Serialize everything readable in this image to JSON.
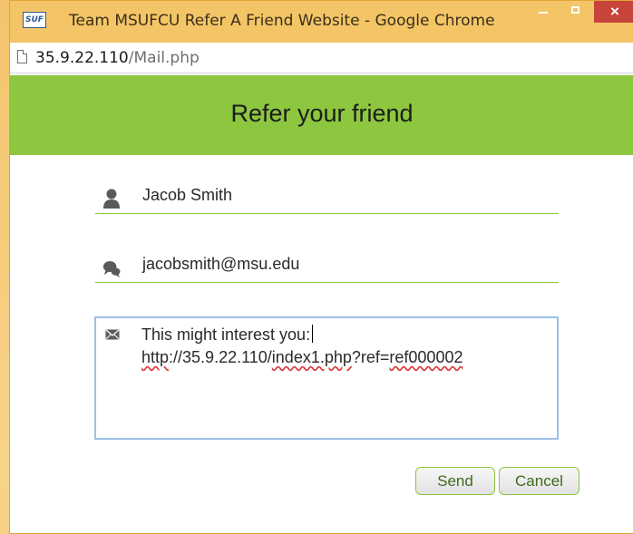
{
  "window": {
    "title": "Team MSUFCU Refer A Friend Website - Google Chrome",
    "logo_text": "SUF",
    "controls": {
      "close_label": "×"
    }
  },
  "urlbar": {
    "host": "35.9.22.110",
    "path": "/Mail.php"
  },
  "page": {
    "header_title": "Refer your friend",
    "name_value": "Jacob Smith",
    "email_value": "jacobsmith@msu.edu",
    "message": {
      "line1": "This might interest you:",
      "line2_prefix": "http",
      "line2_middle": "://35.9.22.110/",
      "line2_file": "index1.php",
      "line2_query": "?ref=",
      "line2_ref": "ref000002"
    },
    "send_label": "Send",
    "cancel_label": "Cancel"
  },
  "colors": {
    "accent_green": "#8dc63f",
    "titlebar": "#f4c567",
    "close_red": "#c7443a",
    "textarea_focus": "#9bc1e8"
  },
  "icons": [
    "app-logo",
    "page-icon",
    "user-icon",
    "chat-bubbles-icon",
    "envelope-icon"
  ]
}
